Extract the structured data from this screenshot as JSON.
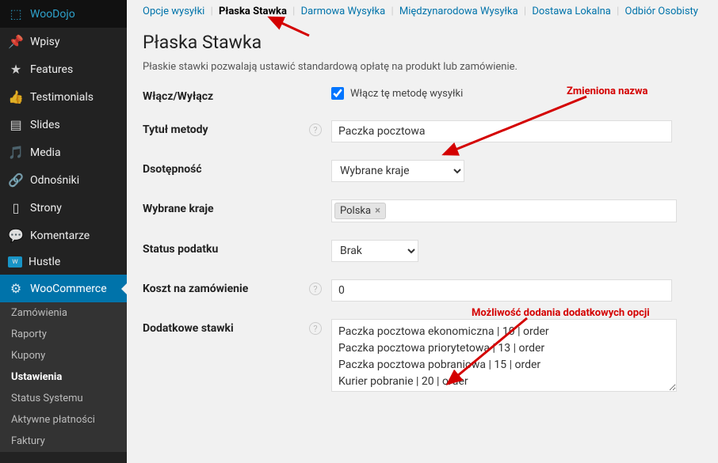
{
  "sidebar": {
    "items": [
      {
        "icon": "⬚",
        "label": "WooDojo"
      },
      {
        "icon": "✎",
        "label": "Wpisy"
      },
      {
        "icon": "★",
        "label": "Features"
      },
      {
        "icon": "👍",
        "label": "Testimonials"
      },
      {
        "icon": "▤",
        "label": "Slides"
      },
      {
        "icon": "🎵",
        "label": "Media"
      },
      {
        "icon": "🔗",
        "label": "Odnośniki"
      },
      {
        "icon": "▯",
        "label": "Strony"
      },
      {
        "icon": "💬",
        "label": "Komentarze"
      },
      {
        "icon": "▦",
        "label": "Hustle"
      },
      {
        "icon": "⚙",
        "label": "WooCommerce"
      }
    ],
    "submenu": [
      "Zamówienia",
      "Raporty",
      "Kupony",
      "Ustawienia",
      "Status Systemu",
      "Aktywne płatności",
      "Faktury"
    ]
  },
  "subnav": {
    "items": [
      "Opcje wysyłki",
      "Płaska Stawka",
      "Darmowa Wysyłka",
      "Międzynarodowa Wysyłka",
      "Dostawa Lokalna",
      "Odbiór Osobisty"
    ],
    "current_index": 1
  },
  "page": {
    "title": "Płaska Stawka",
    "description": "Płaskie stawki pozwalają ustawić standardową opłatę na produkt lub zamówienie."
  },
  "form": {
    "enable_label": "Włącz/Wyłącz",
    "enable_checkbox_label": "Włącz tę metodę wysyłki",
    "enable_checked": true,
    "title_label": "Tytuł metody",
    "title_value": "Paczka pocztowa",
    "availability_label": "Dsotępność",
    "availability_value": "Wybrane kraje",
    "countries_label": "Wybrane kraje",
    "countries_tag": "Polska",
    "tax_label": "Status podatku",
    "tax_value": "Brak",
    "cost_label": "Koszt na zamówienie",
    "cost_value": "0",
    "rates_label": "Dodatkowe stawki",
    "rates_value": "Paczka pocztowa ekonomiczna | 10 | order\nPaczka pocztowa priorytetowa | 13 | order\nPaczka pocztowa pobraniowa | 15 | order\nKurier pobranie | 20 | order"
  },
  "annotations": {
    "a1": "Zmieniona nazwa",
    "a2": "Możliwość dodania dodatkowych opcji"
  }
}
